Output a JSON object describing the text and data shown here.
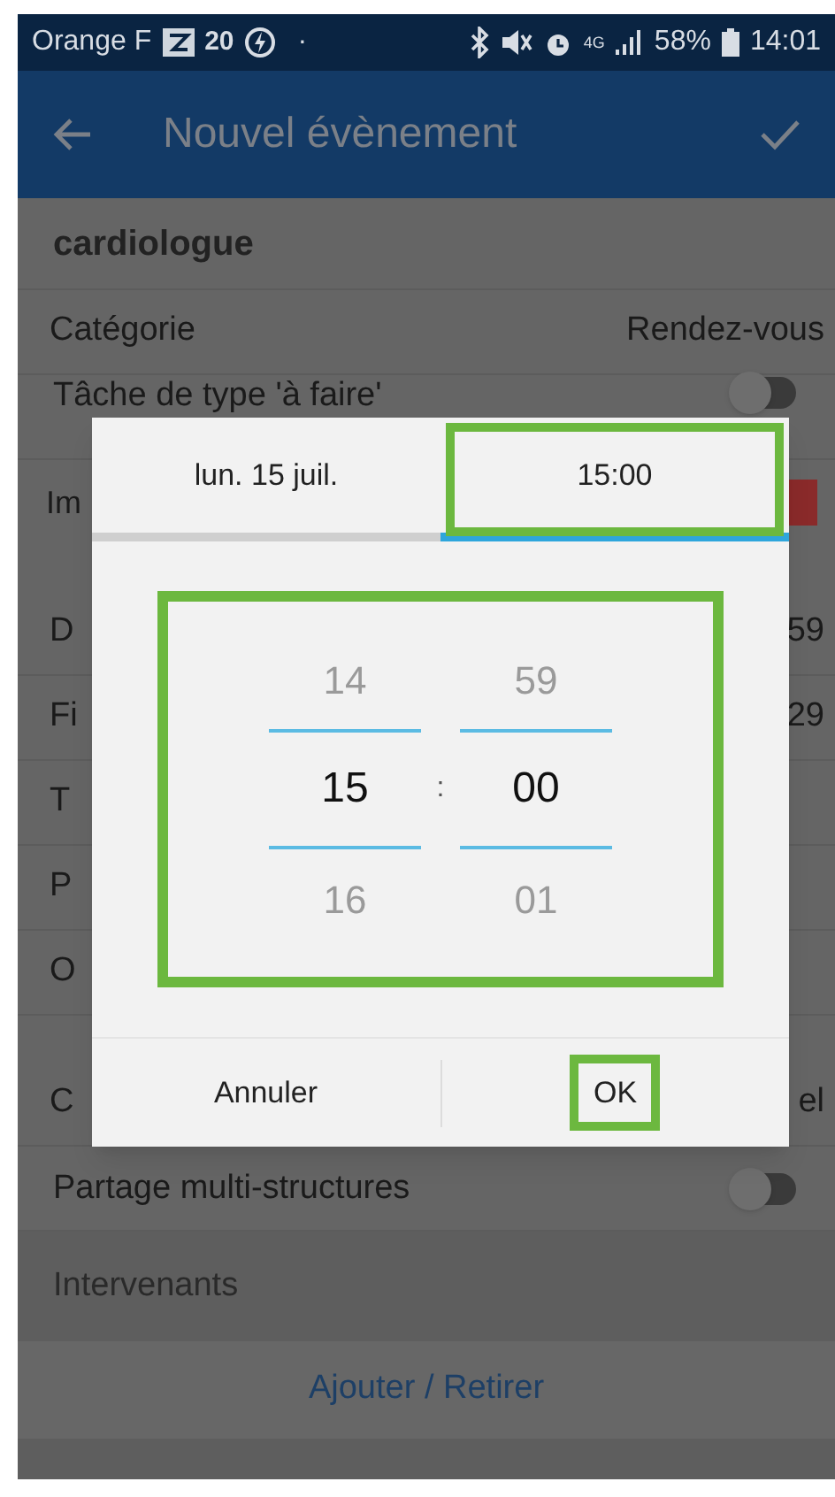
{
  "status_bar": {
    "carrier": "Orange F",
    "badge": "20",
    "dot": "·",
    "network": "4G",
    "battery": "58%",
    "time": "14:01"
  },
  "app_bar": {
    "title": "Nouvel évènement"
  },
  "sections": [
    {
      "rows": [
        {
          "kind": "title",
          "label": "cardiologue"
        },
        {
          "kind": "value",
          "label": "Catégorie",
          "value": "Rendez-vous"
        },
        {
          "kind": "toggle",
          "label": "Tâche de type 'à faire'",
          "on": false
        },
        {
          "kind": "color",
          "label": "Im",
          "color": "#8a2a2a"
        }
      ]
    },
    {
      "rows": [
        {
          "kind": "value",
          "label": "D",
          "value": "59"
        },
        {
          "kind": "value",
          "label": "Fi",
          "value": "29"
        },
        {
          "kind": "value",
          "label": "T"
        },
        {
          "kind": "value",
          "label": "P"
        },
        {
          "kind": "value",
          "label": "O"
        }
      ]
    },
    {
      "rows": [
        {
          "kind": "value",
          "label": "C",
          "value": "el"
        },
        {
          "kind": "toggle",
          "label": "Partage multi-structures",
          "on": false
        }
      ]
    },
    {
      "rows": [
        {
          "kind": "header",
          "label": "Intervenants"
        },
        {
          "kind": "link",
          "label": "Ajouter / Retirer"
        }
      ]
    }
  ],
  "dialog": {
    "tabs": [
      {
        "label": "lun. 15 juil.",
        "selected": false,
        "highlighted": false
      },
      {
        "label": "15:00",
        "selected": true,
        "highlighted": true
      }
    ],
    "picker": {
      "highlighted": true,
      "separator": ":",
      "columns": [
        {
          "above": "14",
          "value": "15",
          "below": "16"
        },
        {
          "above": "59",
          "value": "00",
          "below": "01"
        }
      ]
    },
    "buttons": [
      {
        "label": "Annuler",
        "highlighted": false
      },
      {
        "label": "OK",
        "highlighted": true
      }
    ]
  }
}
